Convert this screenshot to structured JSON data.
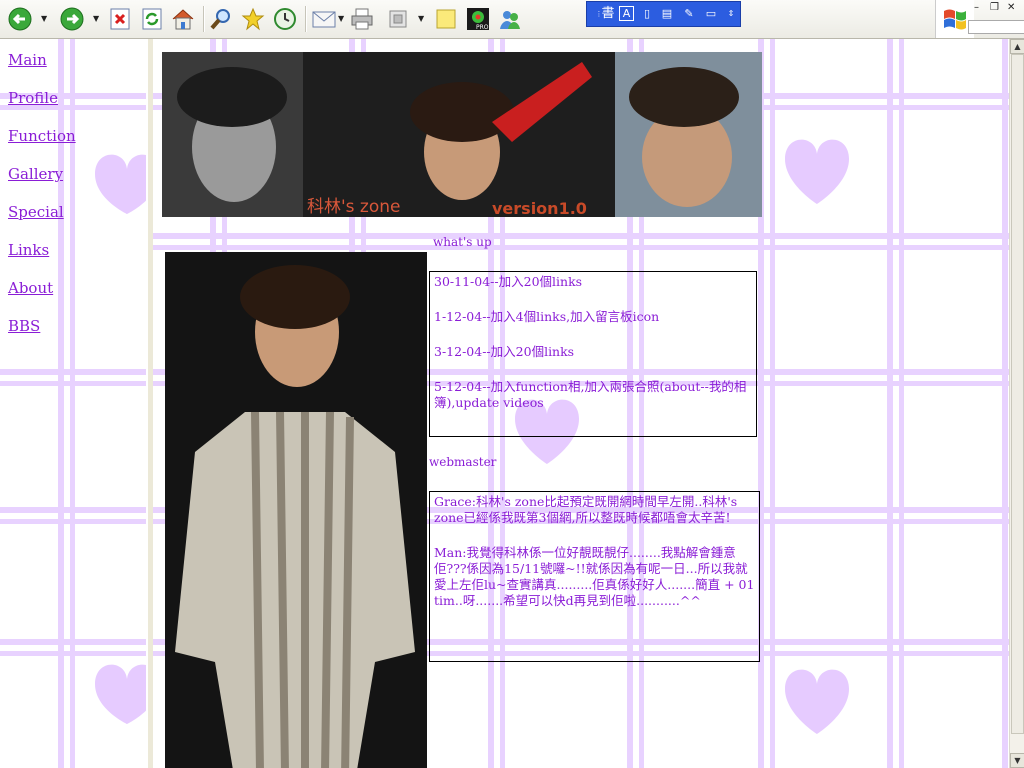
{
  "toolbar": {
    "icons": [
      "back-icon",
      "forward-icon",
      "stop-icon",
      "refresh-icon",
      "home-icon",
      "search-icon",
      "favorites-icon",
      "history-icon",
      "mail-icon",
      "print-icon",
      "edit-icon",
      "discuss-icon",
      "icq-icon",
      "messenger-icon"
    ],
    "language_bar": {
      "ime_label": "書",
      "items": [
        "A",
        "▯",
        "▤",
        "✎",
        "▭"
      ]
    }
  },
  "nav": {
    "items": [
      "Main",
      "Profile",
      "Function",
      "Gallery",
      "Special",
      "Links",
      "About",
      "BBS"
    ]
  },
  "banner": {
    "brand_text": "科林's zone",
    "version_text": "version1.0"
  },
  "whats_up": {
    "title": "what's up",
    "entries": [
      "30-11-04--加入20個links",
      "1-12-04--加入4個links,加入留言板icon",
      "3-12-04--加入20個links",
      "5-12-04--加入function相,加入兩張合照(about--我的相簿),update videos"
    ]
  },
  "webmaster": {
    "title": "webmaster",
    "messages": [
      "Grace:科林's zone比起預定既開網時間早左開..科林's zone已經係我既第3個網,所以整既時候都唔會太辛苦!",
      "Man:我覺得科林係一位好靚既靚仔........我點解會鍾意佢???係因為15/11號囉~!!就係因為有呢一日...所以我就愛上左佢lu~查實講真.........佢真係好好人.......簡直 + 01 tim..呀.......希望可以快d再見到佢啦...........^^"
    ]
  },
  "colors": {
    "accent": "#8a1dd6",
    "pattern": "#e3c8ff"
  }
}
